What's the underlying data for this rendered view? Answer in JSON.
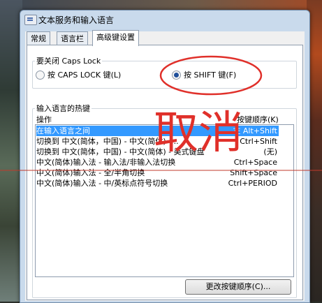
{
  "window": {
    "title": "文本服务和输入语言"
  },
  "tabs": [
    {
      "label": "常规"
    },
    {
      "label": "语言栏"
    },
    {
      "label": "高级键设置"
    }
  ],
  "caps_group": {
    "label": "要关闭 Caps Lock",
    "option1": "按 CAPS LOCK 键(L)",
    "option2": "按 SHIFT 键(F)",
    "selected": "option2"
  },
  "hotkeys": {
    "label": "输入语言的热键",
    "col_action": "操作",
    "col_sequence": "按键顺序(K)",
    "rows": [
      {
        "action": "在输入语言之间",
        "keys": "左 Alt+Shift",
        "selected": true
      },
      {
        "action": "切换到 中文(简体，中国) - 中文(简体) -...",
        "keys": "Ctrl+Shift"
      },
      {
        "action": "切换到 中文(简体，中国) - 中文(简体) - 美式键盘",
        "keys": "(无)"
      },
      {
        "action": "中文(简体)输入法 - 输入法/非输入法切换",
        "keys": "Ctrl+Space"
      },
      {
        "action": "中文(简体)输入法 - 全/半角切换",
        "keys": "Shift+Space"
      },
      {
        "action": "中文(简体)输入法 - 中/英标点符号切换",
        "keys": "Ctrl+PERIOD"
      }
    ],
    "change_button": "更改按键顺序(C)..."
  },
  "annotation": {
    "text": "取消",
    "color": "#e0302a"
  }
}
